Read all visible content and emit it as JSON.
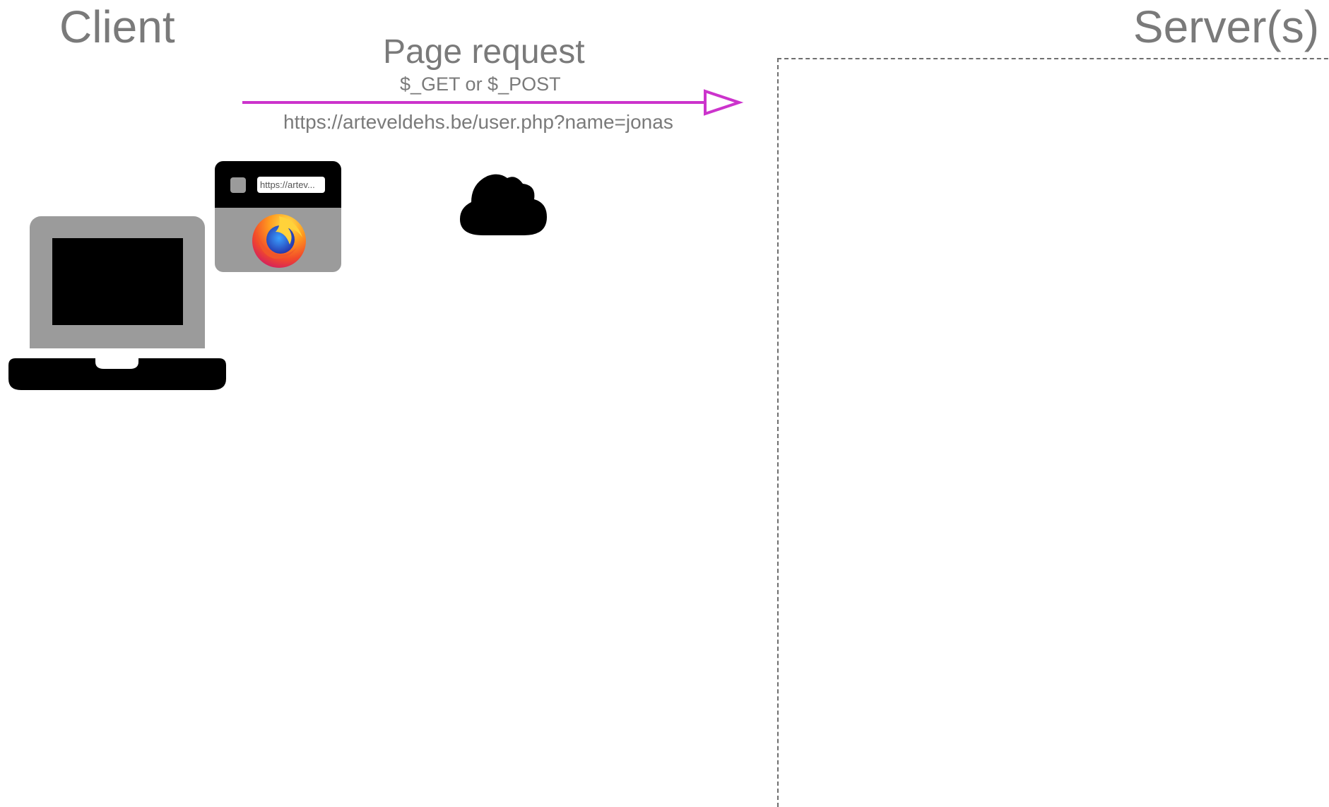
{
  "headings": {
    "client": "Client",
    "server": "Server(s)"
  },
  "request": {
    "title": "Page request",
    "methods": "$_GET or $_POST",
    "url": "https://arteveldehs.be/user.php?name=jonas"
  },
  "browser": {
    "address_text": "https://artev..."
  },
  "icons": {
    "laptop": "laptop-icon",
    "browser": "browser-window-icon",
    "firefox": "firefox-logo-icon",
    "cloud": "cloud-icon"
  },
  "colors": {
    "arrow": "#cc33cc",
    "text": "#7a7a7a",
    "laptop_frame": "#9b9b9b",
    "ink": "#000000"
  }
}
